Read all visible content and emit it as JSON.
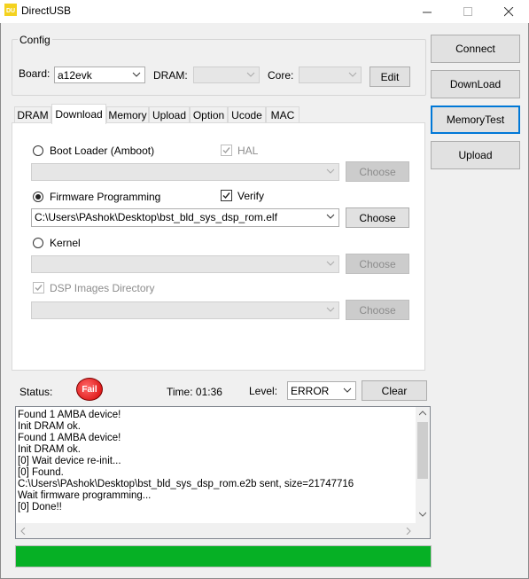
{
  "window": {
    "title": "DirectUSB",
    "icon_text": "DU",
    "controls": {
      "minimize": "─",
      "maximize": "☐",
      "close": "✕"
    }
  },
  "config": {
    "group_label": "Config",
    "board_label": "Board:",
    "board_value": "a12evk",
    "dram_label": "DRAM:",
    "dram_value": "",
    "core_label": "Core:",
    "core_value": "",
    "edit_label": "Edit"
  },
  "side_buttons": {
    "connect": "Connect",
    "download": "DownLoad",
    "memory_test": "MemoryTest",
    "upload": "Upload"
  },
  "tabs": [
    {
      "label": "DRAM",
      "active": false
    },
    {
      "label": "Download",
      "active": true
    },
    {
      "label": "Memory",
      "active": false
    },
    {
      "label": "Upload",
      "active": false
    },
    {
      "label": "Option",
      "active": false
    },
    {
      "label": "Ucode",
      "active": false
    },
    {
      "label": "MAC",
      "active": false
    }
  ],
  "download": {
    "boot_loader": {
      "label": "Boot Loader (Amboot)",
      "selected": false,
      "path": "",
      "choose": "Choose"
    },
    "hal": {
      "label": "HAL",
      "checked": true,
      "enabled": false
    },
    "firmware": {
      "label": "Firmware Programming",
      "selected": true,
      "path": "C:\\Users\\PAshok\\Desktop\\bst_bld_sys_dsp_rom.elf",
      "choose": "Choose"
    },
    "verify": {
      "label": "Verify",
      "checked": true,
      "enabled": true
    },
    "kernel": {
      "label": "Kernel",
      "selected": false,
      "path": "",
      "choose": "Choose"
    },
    "dsp": {
      "label": "DSP Images Directory",
      "checked": true,
      "enabled": false,
      "path": "",
      "choose": "Choose"
    }
  },
  "status": {
    "label": "Status:",
    "badge": "Fail",
    "time_label": "Time: 01:36",
    "level_label": "Level:",
    "level_value": "ERROR",
    "clear_label": "Clear"
  },
  "log_lines": [
    "Found 1 AMBA device!",
    "Init DRAM ok.",
    "Found 1 AMBA device!",
    "Init DRAM ok.",
    "[0] Wait device re-init...",
    "[0] Found.",
    "C:\\Users\\PAshok\\Desktop\\bst_bld_sys_dsp_rom.e2b sent, size=21747716",
    "Wait firmware programming...",
    "[0] Done!!"
  ],
  "progress": {
    "value": 1.0,
    "color": "#06b025"
  },
  "colors": {
    "accent": "#0078d7",
    "fail": "#d50000"
  }
}
